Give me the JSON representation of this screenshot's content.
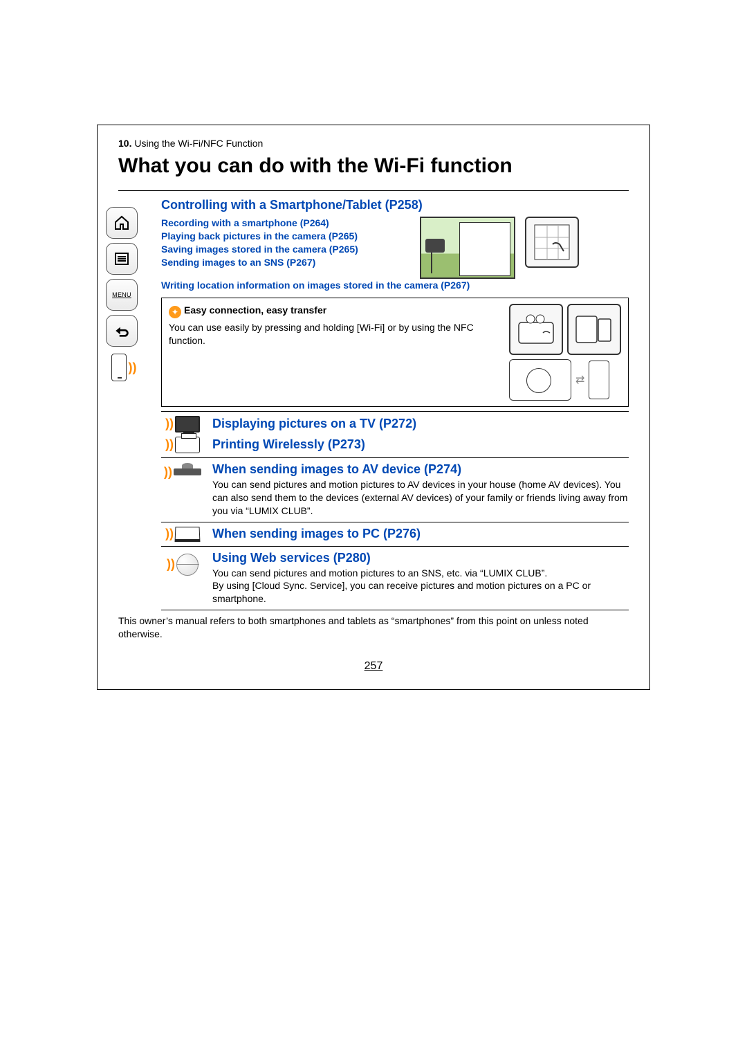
{
  "breadcrumb": {
    "num": "10.",
    "text": " Using the Wi-Fi/NFC Function"
  },
  "title": "What you can do with the Wi-Fi function",
  "sidebar": {
    "menu_label": "MENU"
  },
  "section1": {
    "heading": "Controlling with a Smartphone/Tablet (P258)",
    "links": {
      "l1": "Recording with a smartphone (P264)",
      "l2": "Playing back pictures in the camera (P265)",
      "l3": "Saving images stored in the camera (P265)",
      "l4": "Sending images to an SNS (P267)",
      "l5": "Writing location information on images stored in the camera (P267)"
    },
    "tip_title": "Easy connection, easy transfer",
    "tip_body": "You can use easily by pressing and holding [Wi-Fi] or by using the NFC function."
  },
  "section2": {
    "heading": "Displaying pictures on a TV (P272)"
  },
  "section3": {
    "heading": "Printing Wirelessly (P273)"
  },
  "section4": {
    "heading": "When sending images to AV device (P274)",
    "body": "You can send pictures and motion pictures to AV devices in your house (home AV devices). You can also send them to the devices (external AV devices) of your family or friends living away from you via “LUMIX CLUB”."
  },
  "section5": {
    "heading": "When sending images to PC (P276)"
  },
  "section6": {
    "heading": "Using Web services (P280)",
    "body1": "You can send pictures and motion pictures to an SNS, etc. via “LUMIX CLUB”.",
    "body2": "By using [Cloud Sync. Service], you can receive pictures and motion pictures on a PC or smartphone."
  },
  "footnote": "This owner’s manual refers to both smartphones and tablets as “smartphones” from this point on unless noted otherwise.",
  "page_number": "257"
}
